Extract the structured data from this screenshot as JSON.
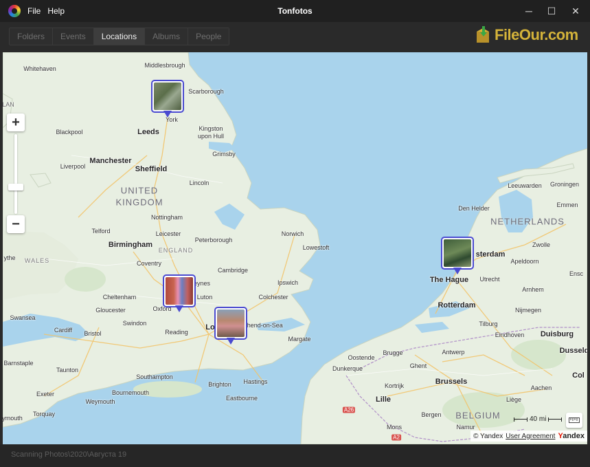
{
  "app": {
    "title": "Tonfotos",
    "menu": [
      "File",
      "Help"
    ],
    "logo_icon": "tonfotos-logo-icon"
  },
  "window_controls": {
    "minimize": "─",
    "maximize": "☐",
    "close": "✕"
  },
  "tabs": [
    {
      "label": "Folders",
      "active": false
    },
    {
      "label": "Events",
      "active": false
    },
    {
      "label": "Locations",
      "active": true
    },
    {
      "label": "Albums",
      "active": false
    },
    {
      "label": "People",
      "active": false
    }
  ],
  "watermark": {
    "text": "FileOur.com"
  },
  "map": {
    "labels": {
      "middlesbrough": "Middlesbrough",
      "whitehaven": "Whitehaven",
      "scarborough": "Scarborough",
      "york": "York",
      "blackpool": "Blackpool",
      "leeds": "Leeds",
      "kingston": "Kingston upon Hull",
      "grimsby": "Grimsby",
      "manchester": "Manchester",
      "liverpool": "Liverpool",
      "sheffield": "Sheffield",
      "lincoln": "Lincoln",
      "uk1": "UNITED",
      "uk2": "KINGDOM",
      "nottingham": "Nottingham",
      "norwich": "Norwich",
      "telford": "Telford",
      "leicester": "Leicester",
      "peterborough": "Peterborough",
      "england": "ENGLAND",
      "lowestoft": "Lowestoft",
      "birmingham": "Birmingham",
      "coventry": "Coventry",
      "wales": "WALES",
      "ythe": "ythe",
      "cambridge": "Cambridge",
      "ipswich": "Ipswich",
      "keynes": "eynes",
      "cheltenham": "Cheltenham",
      "luton": "Luton",
      "colchester": "Colchester",
      "gloucester": "Gloucester",
      "oxford": "Oxford",
      "swansea": "Swansea",
      "swindon": "Swindon",
      "southend": "uthend-on-Sea",
      "cardiff": "Cardiff",
      "bristol": "Bristol",
      "reading": "Reading",
      "london": "Lo",
      "margate": "Margate",
      "barnstaple": "Barnstaple",
      "taunton": "Taunton",
      "southampton": "Southampton",
      "brighton": "Brighton",
      "hastings": "Hastings",
      "exeter": "Exeter",
      "bournemouth": "Bournemouth",
      "eastbourne": "Eastbourne",
      "weymouth": "Weymouth",
      "torquay": "Torquay",
      "ymouth": "ymouth",
      "leeuwarden": "Leeuwarden",
      "groningen": "Groningen",
      "emmen": "Emmen",
      "denhelder": "Den Helder",
      "netherlands": "NETHERLANDS",
      "zwolle": "Zwolle",
      "msterdam": "sterdam",
      "apeldoorn": "Apeldoorn",
      "thehague": "The Hague",
      "utrecht": "Utrecht",
      "arnhem": "Arnhem",
      "enschede": "Ensc",
      "rotterdam": "Rotterdam",
      "nijmegen": "Nijmegen",
      "tilburg": "Tilburg",
      "eindhoven": "Eindhoven",
      "duisburg": "Duisburg",
      "oostende": "Oostende",
      "brugge": "Brugge",
      "antwerp": "Antwerp",
      "dusseldorf": "Dusseld",
      "ghent": "Ghent",
      "dunkerque": "Dunkerque",
      "kortrijk": "Kortrijk",
      "brussels": "Brussels",
      "cologne": "Col",
      "aachen": "Aachen",
      "lille": "Lille",
      "liege": "Liège",
      "belgium": "BELGIUM",
      "mons": "Mons",
      "bergen": "Bergen",
      "namur": "Namur",
      "a26": "A26",
      "a2": "A2",
      "lan": "LAN"
    }
  },
  "zoom": {
    "in_label": "+",
    "out_label": "−",
    "level": 0.34
  },
  "scale": {
    "label": "40 mi"
  },
  "attribution": {
    "copyright": "© Yandex",
    "link": "User Agreement",
    "brand": "Yandex"
  },
  "status": {
    "path": "Scanning Photos\\2020\\Августа 19"
  },
  "colors": {
    "marker_border": "#4a4ad0",
    "watermark": "#d4b33a",
    "sea": "#a9d3ec",
    "land": "#e8efe2"
  }
}
